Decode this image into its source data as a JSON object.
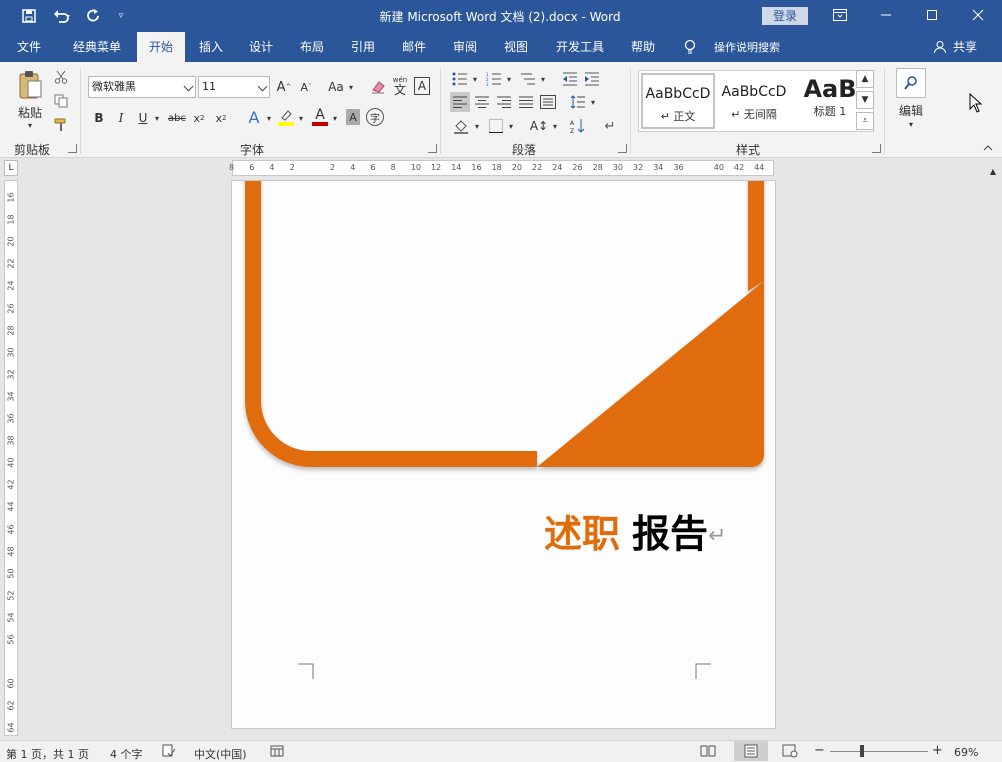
{
  "window": {
    "title": "新建 Microsoft Word 文档 (2).docx  -  Word",
    "login_label": "登录"
  },
  "quick_access": {
    "icons": [
      "save-icon",
      "undo-icon",
      "redo-icon",
      "customize-icon"
    ]
  },
  "tabs": [
    "文件",
    "经典菜单",
    "开始",
    "插入",
    "设计",
    "布局",
    "引用",
    "邮件",
    "审阅",
    "视图",
    "开发工具",
    "帮助"
  ],
  "active_tab": "开始",
  "tell_me": "操作说明搜索",
  "share_label": "共享",
  "ribbon": {
    "clipboard": {
      "label": "剪贴板",
      "paste_label": "粘贴"
    },
    "font": {
      "label": "字体",
      "font_name": "微软雅黑",
      "font_size": "11",
      "change_case": "Aa",
      "phonetic": "wén"
    },
    "paragraph": {
      "label": "段落"
    },
    "styles": {
      "label": "样式",
      "items": [
        {
          "sample": "AaBbCcD",
          "name": "↵ 正文"
        },
        {
          "sample": "AaBbCcD",
          "name": "↵ 无间隔"
        },
        {
          "sample": "AaB",
          "name": "标题 1"
        }
      ]
    },
    "editing": {
      "label": "编辑"
    }
  },
  "ruler": {
    "h_marks": [
      "8",
      "6",
      "4",
      "2",
      "",
      "2",
      "4",
      "6",
      "8",
      "10",
      "12",
      "14",
      "16",
      "18",
      "20",
      "22",
      "24",
      "26",
      "28",
      "30",
      "32",
      "34",
      "36",
      "",
      "40",
      "42",
      "44"
    ],
    "v_marks": [
      "16",
      "18",
      "20",
      "22",
      "24",
      "26",
      "28",
      "30",
      "32",
      "34",
      "36",
      "38",
      "40",
      "42",
      "44",
      "46",
      "48",
      "50",
      "52",
      "54",
      "56",
      "",
      "60",
      "62",
      "64"
    ]
  },
  "document": {
    "title_orange": "述职",
    "title_black": "报告",
    "accent_color": "#e06c0c"
  },
  "status": {
    "page": "第 1 页，共 1 页",
    "words": "4 个字",
    "language": "中文(中国)",
    "zoom": "69%"
  }
}
